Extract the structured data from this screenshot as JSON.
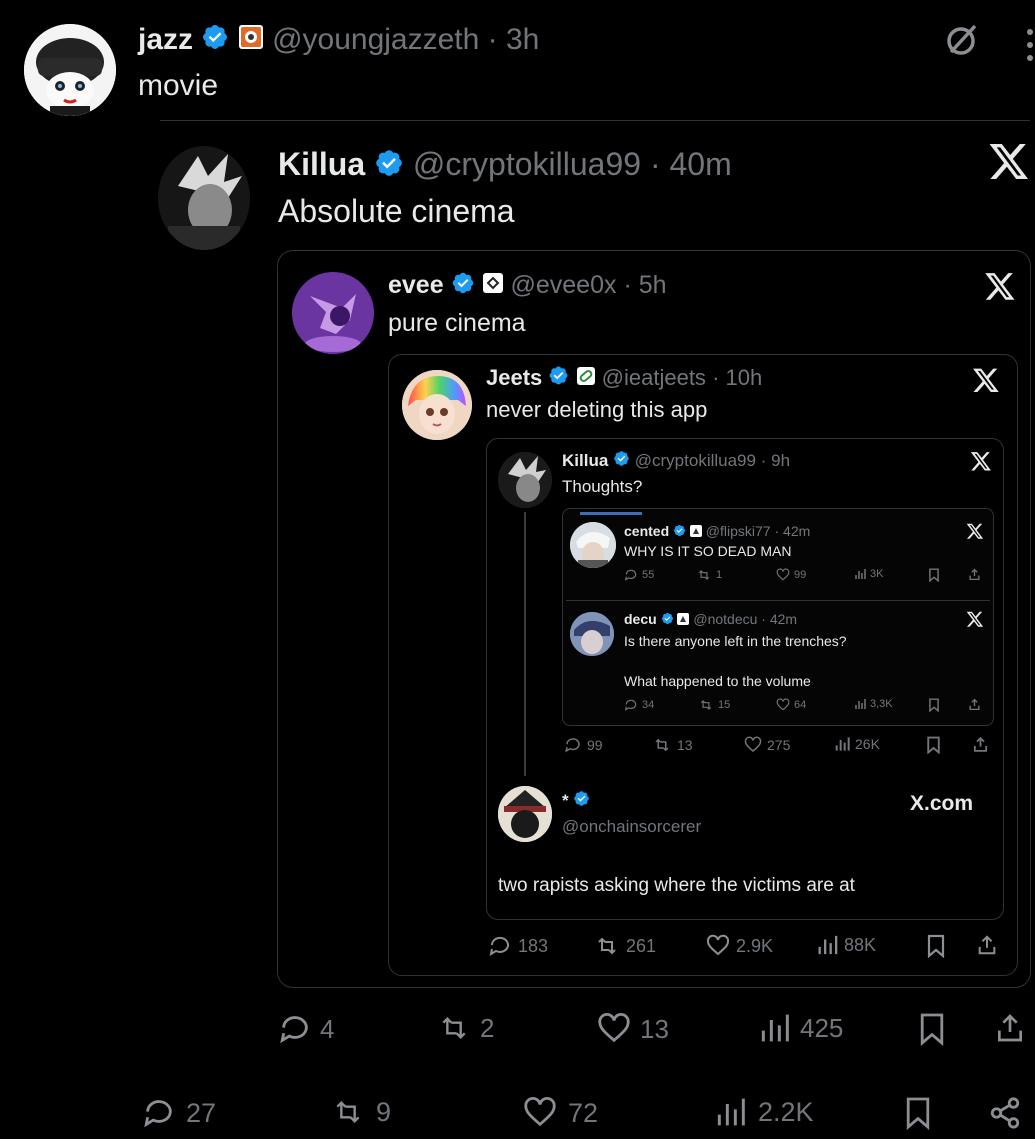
{
  "colors": {
    "background": "#000000",
    "text": "#e7e9ea",
    "muted": "#71767b",
    "verified": "#1d9bf0",
    "border": "#2f3336"
  },
  "outer": {
    "name": "jazz",
    "handle": "@youngjazzeth",
    "sep": "·",
    "time": "3h",
    "text": "movie",
    "actions": {
      "replies": "27",
      "reposts": "9",
      "likes": "72",
      "views": "2.2K"
    }
  },
  "q1": {
    "name": "Killua",
    "handle": "@cryptokillua99",
    "sep": "·",
    "time": "40m",
    "text": "Absolute cinema",
    "actions": {
      "replies": "4",
      "reposts": "2",
      "likes": "13",
      "views": "425"
    }
  },
  "q2": {
    "name": "evee",
    "handle": "@evee0x",
    "sep": "·",
    "time": "5h",
    "text": "pure cinema"
  },
  "q3": {
    "name": "Jeets",
    "handle": "@ieatjeets",
    "sep": "·",
    "time": "10h",
    "text": "never deleting this app",
    "actions": {
      "replies": "183",
      "reposts": "261",
      "likes": "2.9K",
      "views": "88K"
    }
  },
  "q4": {
    "name": "Killua",
    "handle": "@cryptokillua99",
    "sep": "·",
    "time": "9h",
    "text": "Thoughts?",
    "actions": {
      "replies": "99",
      "reposts": "13",
      "likes": "275",
      "views": "26K"
    }
  },
  "q5": {
    "name": "cented",
    "handle": "@flipski77",
    "sep": "·",
    "time": "42m",
    "text": "WHY IS IT SO DEAD MAN",
    "actions": {
      "replies": "55",
      "reposts": "1",
      "likes": "99",
      "views": "3K"
    }
  },
  "q6": {
    "name": "decu",
    "handle": "@notdecu",
    "sep": "·",
    "time": "42m",
    "text1": "Is there anyone left in the trenches?",
    "text2": "What happened to the volume",
    "actions": {
      "replies": "34",
      "reposts": "15",
      "likes": "64",
      "views": "3,3K"
    }
  },
  "reply": {
    "name": "*",
    "handle": "@onchainsorcerer",
    "brand": "X.com",
    "text": "two rapists asking where the victims are at"
  }
}
